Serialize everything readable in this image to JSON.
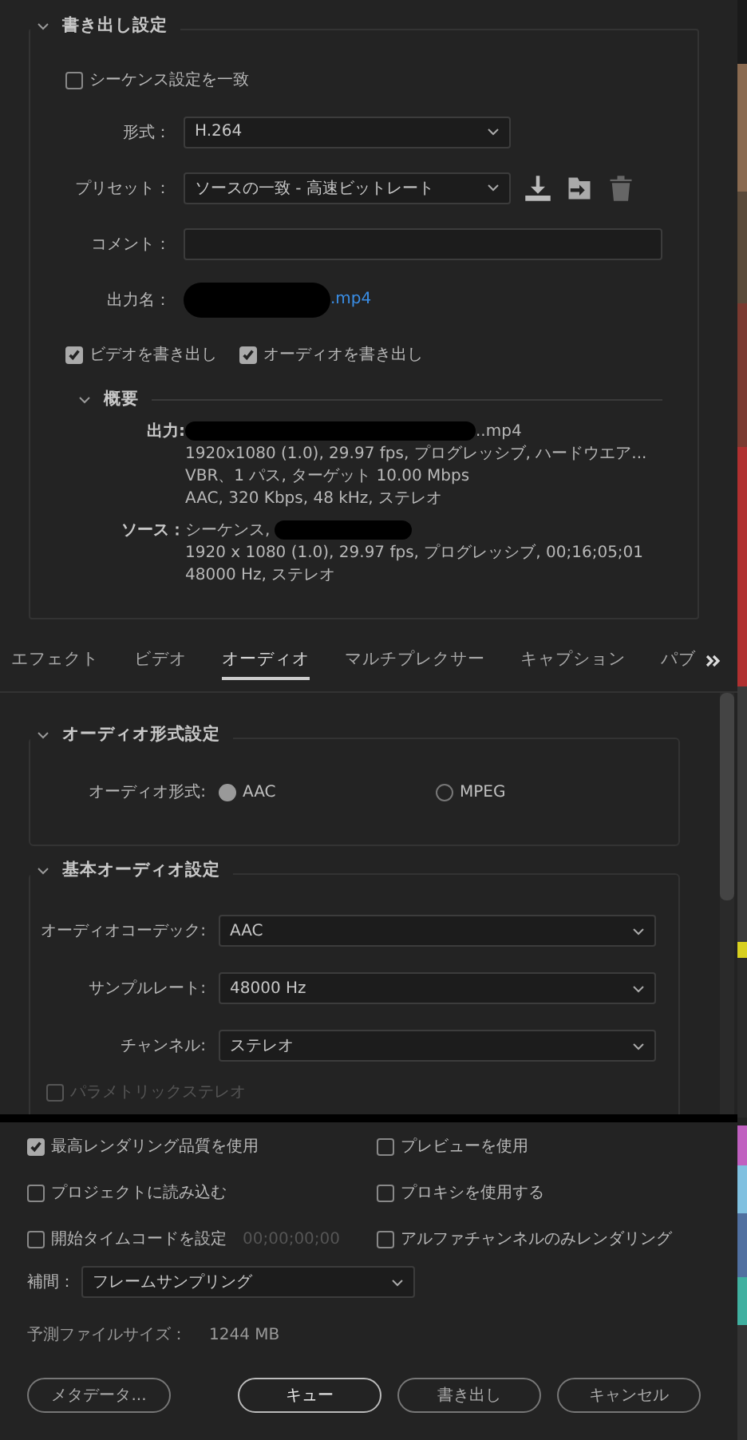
{
  "export_settings": {
    "title": "書き出し設定",
    "match_sequence": {
      "label": "シーケンス設定を一致",
      "checked": false
    },
    "format": {
      "label": "形式：",
      "value": "H.264"
    },
    "preset": {
      "label": "プリセット：",
      "value": "ソースの一致 - 高速ビットレート"
    },
    "comment": {
      "label": "コメント："
    },
    "output_name": {
      "label": "出力名：",
      "value": ".mp4"
    },
    "export_video": {
      "label": "ビデオを書き出し",
      "checked": true
    },
    "export_audio": {
      "label": "オーディオを書き出し",
      "checked": true
    },
    "summary": {
      "title": "概要",
      "output_label": "出力:",
      "output_lines": [
        "..mp4",
        "1920x1080 (1.0), 29.97 fps, プログレッシブ, ハードウエア...",
        "VBR、1 パス, ターゲット 10.00 Mbps",
        "AAC, 320 Kbps, 48 kHz, ステレオ"
      ],
      "source_label": "ソース：",
      "source_lines": [
        "シーケンス,",
        "1920 x 1080 (1.0), 29.97 fps, プログレッシブ, 00;16;05;01",
        "48000  Hz, ステレオ"
      ]
    }
  },
  "tabs": [
    {
      "label": "エフェクト",
      "selected": false
    },
    {
      "label": "ビデオ",
      "selected": false
    },
    {
      "label": "オーディオ",
      "selected": true
    },
    {
      "label": "マルチプレクサー",
      "selected": false
    },
    {
      "label": "キャプション",
      "selected": false
    },
    {
      "label": "パブ",
      "selected": false
    }
  ],
  "audio_format": {
    "title": "オーディオ形式設定",
    "label": "オーディオ形式:",
    "options": [
      {
        "label": "AAC",
        "selected": true
      },
      {
        "label": "MPEG",
        "selected": false
      }
    ]
  },
  "basic_audio": {
    "title": "基本オーディオ設定",
    "fields": [
      {
        "label": "オーディオコーデック:",
        "value": "AAC"
      },
      {
        "label": "サンプルレート:",
        "value": "48000 Hz"
      },
      {
        "label": "チャンネル:",
        "value": "ステレオ"
      }
    ],
    "parametric_stereo": {
      "label": "パラメトリックステレオ",
      "checked": false,
      "disabled": true
    }
  },
  "options": [
    {
      "label": "最高レンダリング品質を使用",
      "checked": true
    },
    {
      "label": "プレビューを使用",
      "checked": false
    },
    {
      "label": "プロジェクトに読み込む",
      "checked": false
    },
    {
      "label": "プロキシを使用する",
      "checked": false
    },
    {
      "label": "開始タイムコードを設定",
      "checked": false,
      "timecode": "00;00;00;00"
    },
    {
      "label": "アルファチャンネルのみレンダリング",
      "checked": false
    }
  ],
  "interpolation": {
    "label": "補間：",
    "value": "フレームサンプリング"
  },
  "file_size": {
    "label": "予測ファイルサイズ：",
    "value": "1244 MB"
  },
  "buttons": [
    {
      "label": "メタデータ...",
      "kind": "secondary"
    },
    {
      "label": "キュー",
      "kind": "primary"
    },
    {
      "label": "書き出し",
      "kind": "secondary"
    },
    {
      "label": "キャンセル",
      "kind": "secondary"
    }
  ]
}
